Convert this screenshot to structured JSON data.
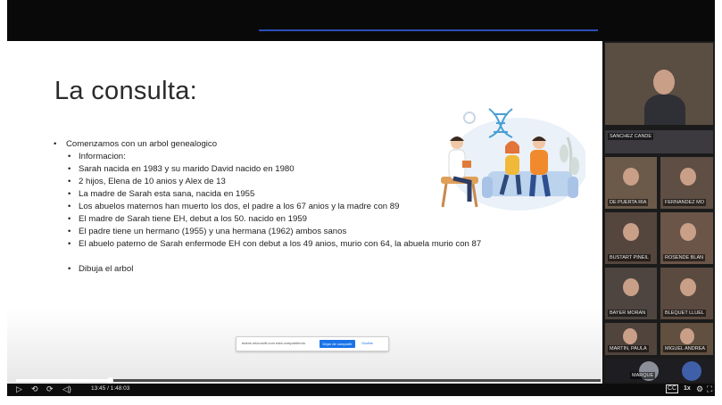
{
  "slide": {
    "title": "La consulta:",
    "bullet_main": "Comenzamos con un arbol genealogico",
    "sub_header": "Informacion:",
    "items": [
      "Sarah nacida en 1983 y su marido David nacido en 1980",
      "2 hijos, Elena de 10 anios y Alex de 13",
      "La madre de Sarah esta sana, nacida en 1955",
      "Los abuelos maternos han muerto los dos, el padre a los 67 anios y la madre con 89",
      "El madre de Sarah tiene EH, debut a los 50. nacido en 1959",
      "El padre tiene un hermano (1955) y una hermana (1962) ambos sanos",
      "El abuelo paterno de Sarah enfermode EH con debut a los 49 anios, murio con 64, la abuela murio con 87"
    ],
    "final_item": "Dibuja el arbol"
  },
  "screen_share": {
    "text": "teams.microsoft.com está compartiendo",
    "stop_label": "Dejar de compartir",
    "hide_label": "Ocultar"
  },
  "participants": [
    {
      "name": "SANCHEZ CANDE"
    },
    {
      "name": "DE PUERTA RIA"
    },
    {
      "name": "FERNANDEZ MO"
    },
    {
      "name": "BUSTART PINEIL"
    },
    {
      "name": "ROSENDE BLAN"
    },
    {
      "name": "BAYER MORAN"
    },
    {
      "name": "BLEQUET LLUEL"
    },
    {
      "name": "MARTIN, PAULA"
    },
    {
      "name": "MIGUEL ANDREA"
    },
    {
      "name": "MARQUE"
    }
  ],
  "player": {
    "current_time": "13:45",
    "duration": "1:48:03",
    "time_display": "13:45 / 1:48:03",
    "progress_fraction": 0.16,
    "speed": "1x",
    "icons": [
      "play-icon",
      "rewind-icon",
      "forward-icon",
      "volume-icon",
      "captions-icon",
      "settings-icon",
      "fullscreen-icon"
    ]
  },
  "colors": {
    "accent": "#1a73e8",
    "top_progress": "#2b4fb8",
    "background": "#0c0c0c"
  }
}
